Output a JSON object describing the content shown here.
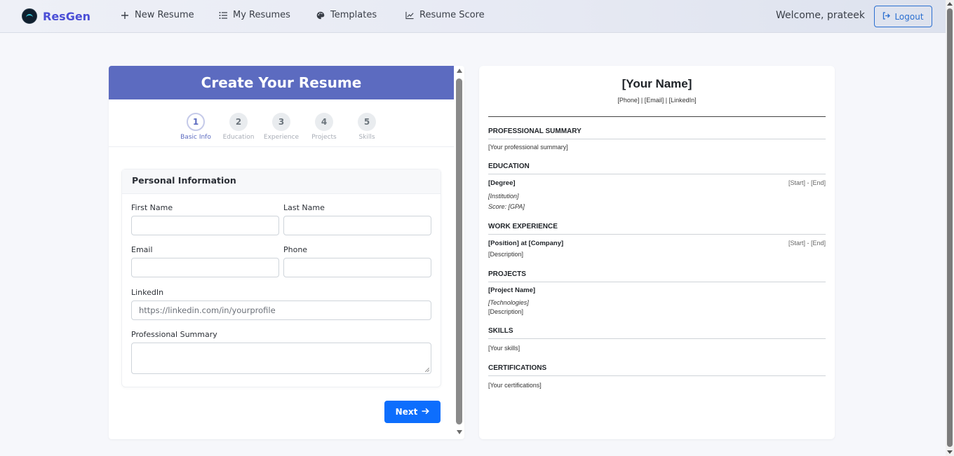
{
  "navbar": {
    "brand": "ResGen",
    "items": [
      {
        "label": "New Resume",
        "icon": "plus-icon"
      },
      {
        "label": "My Resumes",
        "icon": "list-icon"
      },
      {
        "label": "Templates",
        "icon": "palette-icon"
      },
      {
        "label": "Resume Score",
        "icon": "chart-line-icon"
      }
    ],
    "welcome": "Welcome, prateek",
    "logout": "Logout"
  },
  "form": {
    "title": "Create Your Resume",
    "steps": [
      {
        "num": "1",
        "label": "Basic Info",
        "active": true
      },
      {
        "num": "2",
        "label": "Education",
        "active": false
      },
      {
        "num": "3",
        "label": "Experience",
        "active": false
      },
      {
        "num": "4",
        "label": "Projects",
        "active": false
      },
      {
        "num": "5",
        "label": "Skills",
        "active": false
      }
    ],
    "section_title": "Personal Information",
    "fields": {
      "first_name": {
        "label": "First Name",
        "value": ""
      },
      "last_name": {
        "label": "Last Name",
        "value": ""
      },
      "email": {
        "label": "Email",
        "value": ""
      },
      "phone": {
        "label": "Phone",
        "value": ""
      },
      "linkedin": {
        "label": "LinkedIn",
        "placeholder": "https://linkedin.com/in/yourprofile"
      },
      "summary": {
        "label": "Professional Summary",
        "value": ""
      }
    },
    "next": "Next"
  },
  "preview": {
    "name": "[Your Name]",
    "contact": "[Phone] | [Email] | [LinkedIn]",
    "summary_title": "PROFESSIONAL SUMMARY",
    "summary_text": "[Your professional summary]",
    "education_title": "EDUCATION",
    "degree": "[Degree]",
    "edu_dates": "[Start] - [End]",
    "institution": "[Institution]",
    "score": "Score: [GPA]",
    "work_title": "WORK EXPERIENCE",
    "position": "[Position] at [Company]",
    "work_dates": "[Start] - [End]",
    "work_desc": "[Description]",
    "projects_title": "PROJECTS",
    "project_name": "[Project Name]",
    "technologies": "[Technologies]",
    "project_desc": "[Description]",
    "skills_title": "SKILLS",
    "skills_text": "[Your skills]",
    "cert_title": "CERTIFICATIONS",
    "cert_text": "[Your certifications]"
  },
  "colors": {
    "brand": "#4b4fd6",
    "header": "#5c6bc0",
    "primary": "#0d6efd"
  }
}
